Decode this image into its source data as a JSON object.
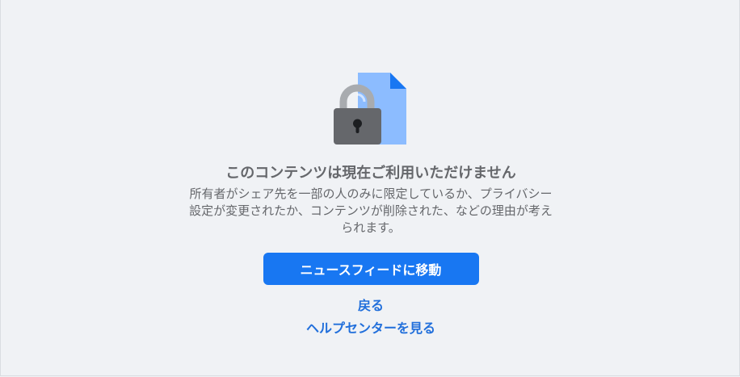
{
  "illustration": {
    "icon": "locked-document-icon",
    "colors": {
      "document": "#8cbcff",
      "document_fold": "#1877f2",
      "lock_body": "#65676b",
      "lock_shackle": "#a8abaf",
      "keyhole": "#1c1e21"
    }
  },
  "message": {
    "title": "このコンテンツは現在ご利用いただけません",
    "description": "所有者がシェア先を一部の人のみに限定しているか、プライバシー設定が変更されたか、コンテンツが削除された、などの理由が考えられます。"
  },
  "actions": {
    "primary_label": "ニュースフィードに移動",
    "back_label": "戻る",
    "help_label": "ヘルプセンターを見る"
  },
  "colors": {
    "background": "#f0f2f5",
    "primary": "#1877f2",
    "link": "#216fdb",
    "text_secondary": "#65676b"
  }
}
